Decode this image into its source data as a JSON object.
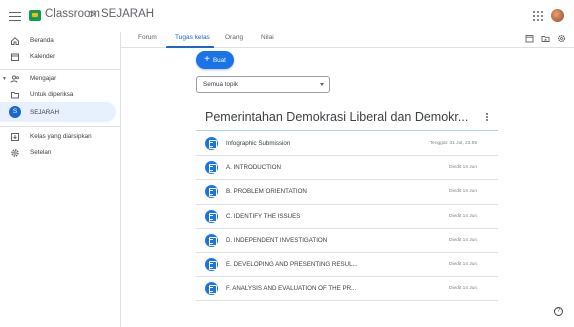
{
  "header": {
    "app_title": "Classroom",
    "separator": ">",
    "class_name": "SEJARAH"
  },
  "sidebar": {
    "items": [
      {
        "label": "Beranda",
        "icon": "home-icon"
      },
      {
        "label": "Kalender",
        "icon": "calendar-icon"
      },
      {
        "label": "Mengajar",
        "icon": "people-icon"
      },
      {
        "label": "Untuk diperiksa",
        "icon": "review-icon"
      },
      {
        "label": "SEJARAH",
        "badge": "S"
      },
      {
        "label": "Kelas yang diarsipkan",
        "icon": "archive-icon"
      },
      {
        "label": "Setelan",
        "icon": "gear-icon"
      }
    ]
  },
  "tabs": {
    "items": [
      {
        "label": "Forum"
      },
      {
        "label": "Tugas kelas"
      },
      {
        "label": "Orang"
      },
      {
        "label": "Nilai"
      }
    ],
    "active": "Tugas kelas"
  },
  "actions": {
    "create_label": "Buat",
    "topic_filter": "Semua topik"
  },
  "topic": {
    "title": "Pemerintahan Demokrasi Liberal dan Demokr...",
    "assignments": [
      {
        "title": "Infographic Submission",
        "meta": "Tenggat: 31 Jul, 23.59"
      },
      {
        "title": "A. INTRODUCTION",
        "meta": "Diedit 14 Jun"
      },
      {
        "title": "B. PROBLEM ORIENTATION",
        "meta": "Diedit 14 Jun"
      },
      {
        "title": "C. IDENTIFY THE ISSUES",
        "meta": "Diedit 14 Jun"
      },
      {
        "title": "D. INDEPENDENT INVESTIGATION",
        "meta": "Diedit 14 Jun"
      },
      {
        "title": "E. DEVELOPING AND PRESENTING RESUL...",
        "meta": "Diedit 14 Jun"
      },
      {
        "title": "F. ANALYSIS AND EVALUATION OF THE PR...",
        "meta": "Diedit 14 Jun"
      }
    ]
  },
  "help": {
    "label": "?"
  },
  "colors": {
    "accent": "#1a73e8",
    "active_nav_bg": "#e8f0fe",
    "logo_green": "#0f9d58"
  }
}
